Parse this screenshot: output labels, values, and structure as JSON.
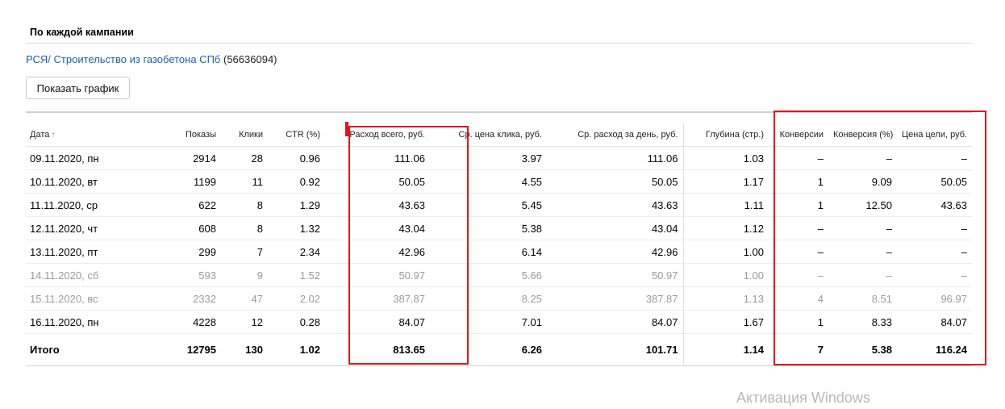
{
  "section": {
    "title": "По каждой кампании"
  },
  "campaign": {
    "name": "РСЯ/ Строительство из газобетона СПб",
    "id_text": "(56636094)"
  },
  "buttons": {
    "show_chart": "Показать график"
  },
  "table": {
    "headers": {
      "date": "Дата",
      "sort_arrow": "↑",
      "shows": "Показы",
      "clicks": "Клики",
      "ctr": "CTR (%)",
      "spend_total": "Расход всего, руб.",
      "avg_cpc": "Ср. цена клика, руб.",
      "avg_daily_spend": "Ср. расход за день, руб.",
      "depth": "Глубина (стр.)",
      "conversions": "Конверсии",
      "conversion_rate": "Конверсия (%)",
      "goal_cost": "Цена цели, руб."
    },
    "rows": [
      {
        "date": "09.11.2020, пн",
        "shows": "2914",
        "clicks": "28",
        "ctr": "0.96",
        "spend_total": "111.06",
        "avg_cpc": "3.97",
        "avg_daily_spend": "111.06",
        "depth": "1.03",
        "conversions": "–",
        "conversion_rate": "–",
        "goal_cost": "–"
      },
      {
        "date": "10.11.2020, вт",
        "shows": "1199",
        "clicks": "11",
        "ctr": "0.92",
        "spend_total": "50.05",
        "avg_cpc": "4.55",
        "avg_daily_spend": "50.05",
        "depth": "1.17",
        "conversions": "1",
        "conversion_rate": "9.09",
        "goal_cost": "50.05"
      },
      {
        "date": "11.11.2020, ср",
        "shows": "622",
        "clicks": "8",
        "ctr": "1.29",
        "spend_total": "43.63",
        "avg_cpc": "5.45",
        "avg_daily_spend": "43.63",
        "depth": "1.11",
        "conversions": "1",
        "conversion_rate": "12.50",
        "goal_cost": "43.63"
      },
      {
        "date": "12.11.2020, чт",
        "shows": "608",
        "clicks": "8",
        "ctr": "1.32",
        "spend_total": "43.04",
        "avg_cpc": "5.38",
        "avg_daily_spend": "43.04",
        "depth": "1.12",
        "conversions": "–",
        "conversion_rate": "–",
        "goal_cost": "–"
      },
      {
        "date": "13.11.2020, пт",
        "shows": "299",
        "clicks": "7",
        "ctr": "2.34",
        "spend_total": "42.96",
        "avg_cpc": "6.14",
        "avg_daily_spend": "42.96",
        "depth": "1.00",
        "conversions": "–",
        "conversion_rate": "–",
        "goal_cost": "–"
      },
      {
        "date": "14.11.2020, сб",
        "shows": "593",
        "clicks": "9",
        "ctr": "1.52",
        "spend_total": "50.97",
        "avg_cpc": "5.66",
        "avg_daily_spend": "50.97",
        "depth": "1.00",
        "conversions": "–",
        "conversion_rate": "–",
        "goal_cost": "–"
      },
      {
        "date": "15.11.2020, вс",
        "shows": "2332",
        "clicks": "47",
        "ctr": "2.02",
        "spend_total": "387.87",
        "avg_cpc": "8.25",
        "avg_daily_spend": "387.87",
        "depth": "1.13",
        "conversions": "4",
        "conversion_rate": "8.51",
        "goal_cost": "96.97"
      },
      {
        "date": "16.11.2020, пн",
        "shows": "4228",
        "clicks": "12",
        "ctr": "0.28",
        "spend_total": "84.07",
        "avg_cpc": "7.01",
        "avg_daily_spend": "84.07",
        "depth": "1.67",
        "conversions": "1",
        "conversion_rate": "8.33",
        "goal_cost": "84.07"
      }
    ],
    "total": {
      "label": "Итого",
      "shows": "12795",
      "clicks": "130",
      "ctr": "1.02",
      "spend_total": "813.65",
      "avg_cpc": "6.26",
      "avg_daily_spend": "101.71",
      "depth": "1.14",
      "conversions": "7",
      "conversion_rate": "5.38",
      "goal_cost": "116.24"
    }
  },
  "watermark": {
    "text": "Активация Windows"
  },
  "colors": {
    "link": "#1a5fb4",
    "highlight": "#e3131b",
    "weekend_text": "#9a9a9a"
  }
}
